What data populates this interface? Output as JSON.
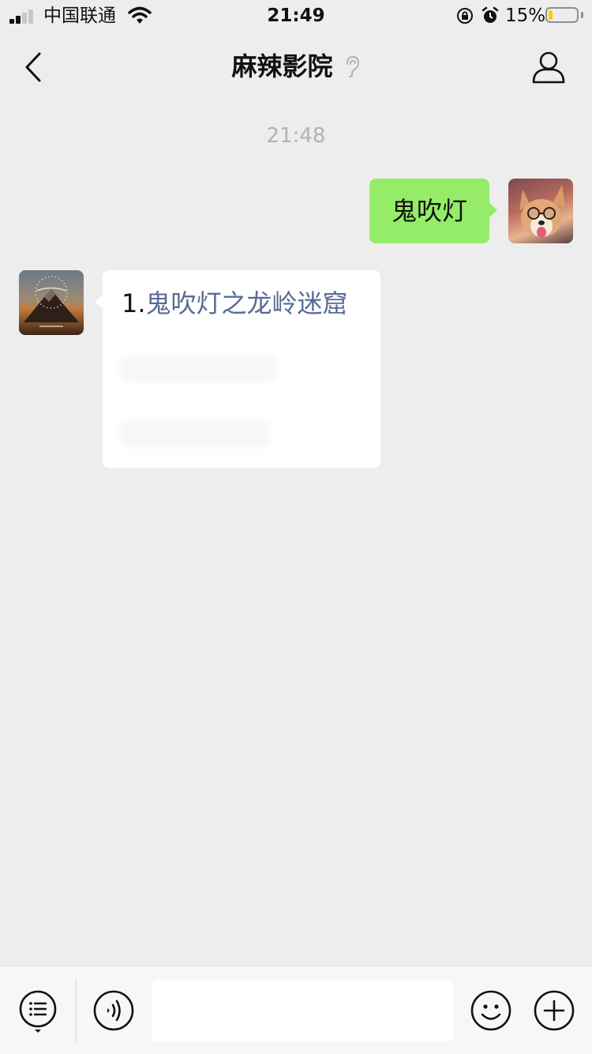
{
  "status_bar": {
    "carrier": "中国联通",
    "time": "21:49",
    "battery_percent": "15%",
    "battery_level": 0.15,
    "icons": [
      "signal-icon",
      "wifi-icon",
      "orientation-lock-icon",
      "alarm-icon",
      "battery-icon"
    ]
  },
  "header": {
    "title": "麻辣影院",
    "icons": [
      "back-chevron-icon",
      "mute-ear-icon",
      "profile-icon"
    ]
  },
  "chat": {
    "timestamp": "21:48",
    "messages": [
      {
        "sender": "me",
        "text": "鬼吹灯"
      },
      {
        "sender": "official-account",
        "number": "1.",
        "link_text": "鬼吹灯之龙岭迷窟"
      }
    ]
  },
  "input_bar": {
    "text_value": "",
    "icons": [
      "menu-list-icon",
      "voice-icon",
      "emoji-icon",
      "plus-icon"
    ]
  },
  "colors": {
    "background": "#ededed",
    "my_bubble": "#95ec69",
    "link": "#576b95",
    "timestamp": "#b2b2b2",
    "battery_fill": "#ffcc00"
  }
}
